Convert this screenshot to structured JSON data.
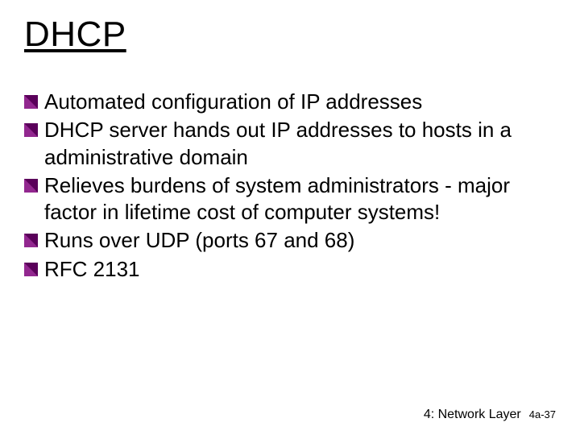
{
  "title": "DHCP",
  "bullets": [
    "Automated configuration of IP addresses",
    "DHCP server hands out IP addresses to hosts in a administrative domain",
    "Relieves burdens of system administrators - major factor in lifetime cost of computer systems!",
    "Runs over UDP (ports 67 and 68)",
    "RFC 2131"
  ],
  "footer": {
    "chapter": "4: Network Layer",
    "page": "4a-37"
  }
}
